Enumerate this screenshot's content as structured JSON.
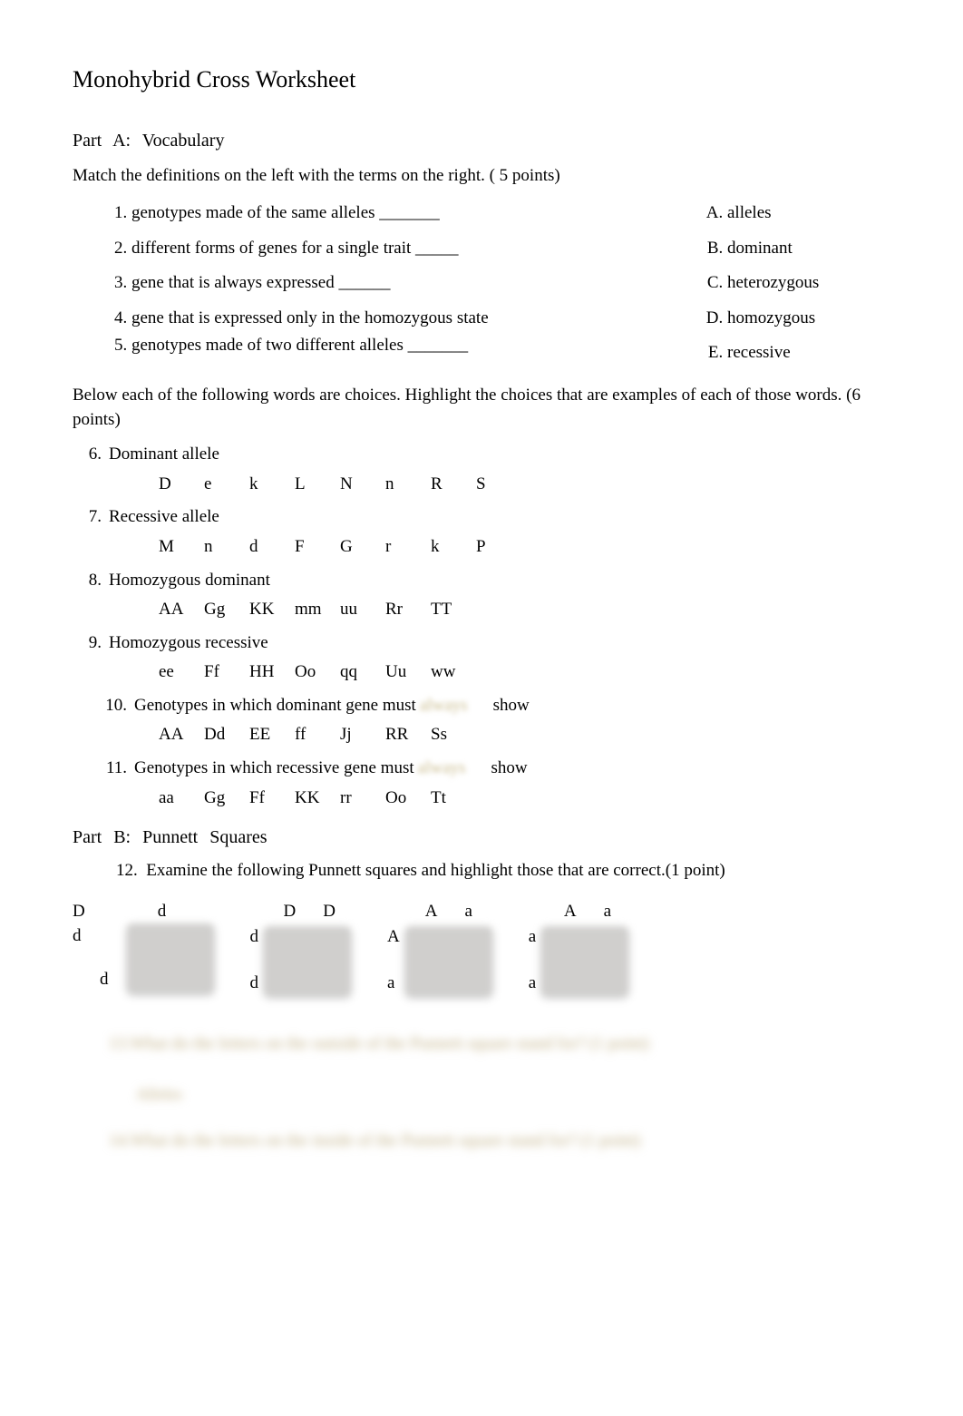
{
  "title": "Monohybrid Cross Worksheet",
  "partA": {
    "header": "Part   A:  Vocabulary",
    "instruction": "Match the definitions on the left with the terms on the right. ( 5 points)",
    "questions": [
      "genotypes made of the same alleles _______",
      "different forms of genes for a single trait _____",
      "gene that is always expressed ______",
      "gene that is expressed only in the homozygous state",
      "genotypes made of two different alleles _______"
    ],
    "terms": [
      "alleles",
      "dominant",
      "heterozygous",
      "homozygous",
      "recessive"
    ],
    "instruction2": "Below each of the following words are choices. Highlight the choices that are examples of each of those words. (6 points)",
    "highlightQ": [
      {
        "num": "6.",
        "label": "Dominant allele",
        "choices": [
          "D",
          "e",
          "k",
          "L",
          "N",
          "n",
          "R",
          "S"
        ]
      },
      {
        "num": "7.",
        "label": "Recessive allele",
        "choices": [
          "M",
          "n",
          "d",
          "F",
          "G",
          "r",
          "k",
          "P"
        ]
      },
      {
        "num": "8.",
        "label": "Homozygous dominant",
        "choices": [
          "AA",
          "Gg",
          "KK",
          "mm",
          "uu",
          "Rr",
          "TT"
        ]
      },
      {
        "num": "9.",
        "label": "Homozygous recessive",
        "choices": [
          "ee",
          "Ff",
          "HH",
          "Oo",
          "qq",
          "Uu",
          "ww"
        ]
      },
      {
        "num": "10.",
        "label": "Genotypes in which dominant gene must",
        "always": "always",
        "tail": "show",
        "choices": [
          "AA",
          "Dd",
          "EE",
          "ff",
          "Jj",
          "RR",
          "Ss"
        ]
      },
      {
        "num": "11.",
        "label": "Genotypes in which recessive gene must",
        "always": "always",
        "tail": "show",
        "choices": [
          "aa",
          "Gg",
          "Ff",
          "KK",
          "rr",
          "Oo",
          "Tt"
        ]
      }
    ]
  },
  "partB": {
    "header": "Part   B:  Punnett    Squares",
    "q12num": "12.",
    "q12": "Examine the following Punnett squares and highlight those that are correct.(1 point)",
    "squares": [
      {
        "top": [
          "D",
          "d"
        ],
        "left": [
          "d",
          "d"
        ],
        "style": "first"
      },
      {
        "top": [
          "D",
          "D"
        ],
        "left": [
          "d",
          "d"
        ]
      },
      {
        "top": [
          "A",
          "a"
        ],
        "left": [
          "A",
          "a"
        ]
      },
      {
        "top": [
          "A",
          "a"
        ],
        "left": [
          "a",
          "a"
        ]
      }
    ],
    "blur1": "13.What do the letters on the outside of the Punnett square stand for? (1 point)",
    "blur1sub": "Alleles",
    "blur2": "14.What do the letters on the inside of the Punnett square stand for? (1 point)"
  }
}
